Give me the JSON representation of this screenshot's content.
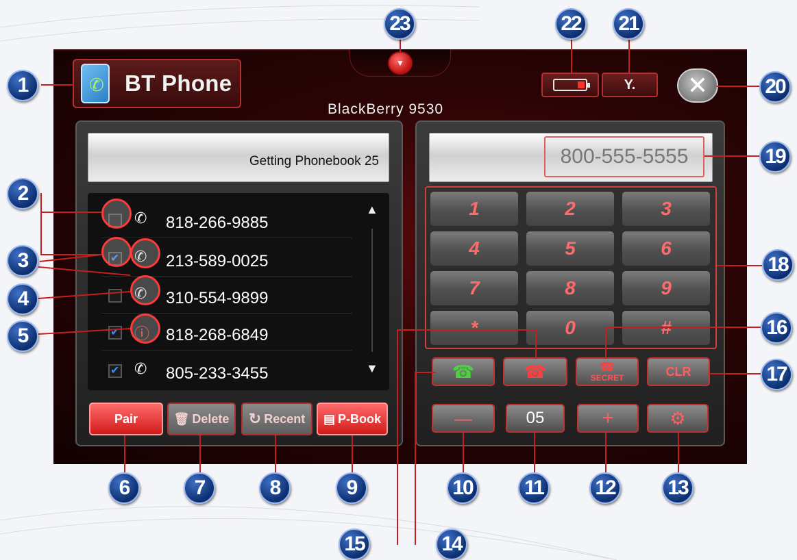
{
  "app": {
    "title": "BT Phone",
    "device_name": "BlackBerry 9530",
    "status_text": "Getting Phonebook 25",
    "dial_number": "800-555-5555"
  },
  "icons": {
    "dropdown": "chevron-down-icon",
    "battery": "battery-icon",
    "signal": "signal-icon",
    "close": "close-icon"
  },
  "contacts": [
    {
      "number": "818-266-9885",
      "checked": false,
      "icon": "incoming-call-icon"
    },
    {
      "number": "213-589-0025",
      "checked": true,
      "icon": "outgoing-call-icon"
    },
    {
      "number": "310-554-9899",
      "checked": false,
      "icon": "incoming-call-icon"
    },
    {
      "number": "818-268-6849",
      "checked": true,
      "icon": "missed-call-icon"
    },
    {
      "number": "805-233-3455",
      "checked": true,
      "icon": "incoming-call-icon"
    }
  ],
  "buttons": {
    "pair": "Pair",
    "delete": "Delete",
    "recent": "Recent",
    "pbook": "P-Book",
    "secret": "SECRET",
    "clr": "CLR",
    "minus": "—",
    "volume": "05",
    "plus": "+"
  },
  "keypad": [
    "1",
    "2",
    "3",
    "4",
    "5",
    "6",
    "7",
    "8",
    "9",
    "*",
    "0",
    "#"
  ],
  "callouts": [
    "1",
    "2",
    "3",
    "4",
    "5",
    "6",
    "7",
    "8",
    "9",
    "10",
    "11",
    "12",
    "13",
    "14",
    "15",
    "16",
    "17",
    "18",
    "19",
    "20",
    "21",
    "22",
    "23"
  ]
}
